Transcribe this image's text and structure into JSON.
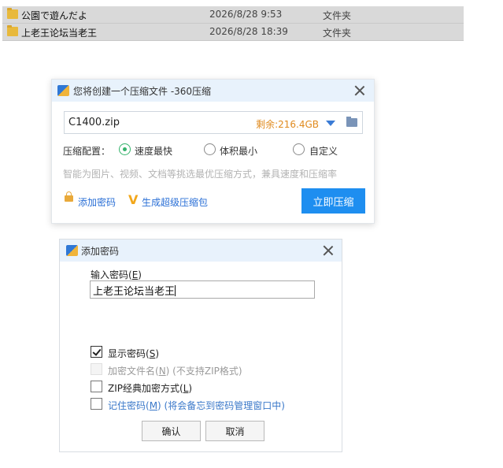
{
  "file_list": [
    {
      "name": "公園で遊んだよ",
      "date": "2026/8/28 9:53",
      "type": "文件夹"
    },
    {
      "name": "上老王论坛当老王",
      "date": "2026/8/28 18:39",
      "type": "文件夹"
    }
  ],
  "compress_dialog": {
    "title": "您将创建一个压缩文件 -360压缩",
    "file_path": "C1400.zip",
    "free_space": "剩余:216.4GB",
    "config_label": "压缩配置：",
    "options": [
      {
        "label": "速度最快",
        "checked": true
      },
      {
        "label": "体积最小",
        "checked": false
      },
      {
        "label": "自定义",
        "checked": false
      }
    ],
    "hint": "智能为图片、视频、文档等挑选最优压缩方式，兼具速度和压缩率",
    "add_password_link": "添加密码",
    "super_package_link": "生成超级压缩包",
    "compress_button": "立即压缩"
  },
  "password_dialog": {
    "title": "添加密码",
    "input_label_prefix": "输入密码(",
    "input_label_key": "E",
    "input_label_suffix": ")",
    "password_value": "上老王论坛当老王",
    "checkboxes": [
      {
        "prefix": "显示密码(",
        "key": "S",
        "suffix": ")",
        "checked": true,
        "disabled": false
      },
      {
        "prefix": "加密文件名(",
        "key": "N",
        "suffix": ") (不支持ZIP格式)",
        "checked": false,
        "disabled": true
      },
      {
        "prefix": "ZIP经典加密方式(",
        "key": "L",
        "suffix": ")",
        "checked": false,
        "disabled": false
      },
      {
        "prefix": "记住密码(",
        "key": "M",
        "suffix": ") (将会备忘到密码管理窗口中)",
        "checked": false,
        "disabled": false
      }
    ],
    "ok_button": "确认",
    "cancel_button": "取消"
  },
  "colors": {
    "accent": "#1e8ef0",
    "link": "#2a6fd6",
    "space_text": "#e08a1e",
    "radio_checked": "#34b36b",
    "titlebar": "#e8f2fc"
  },
  "icons": [
    "folder-icon",
    "app-icon",
    "close-icon",
    "chevron-down-icon",
    "browse-folder-icon",
    "lock-icon",
    "v-icon"
  ]
}
